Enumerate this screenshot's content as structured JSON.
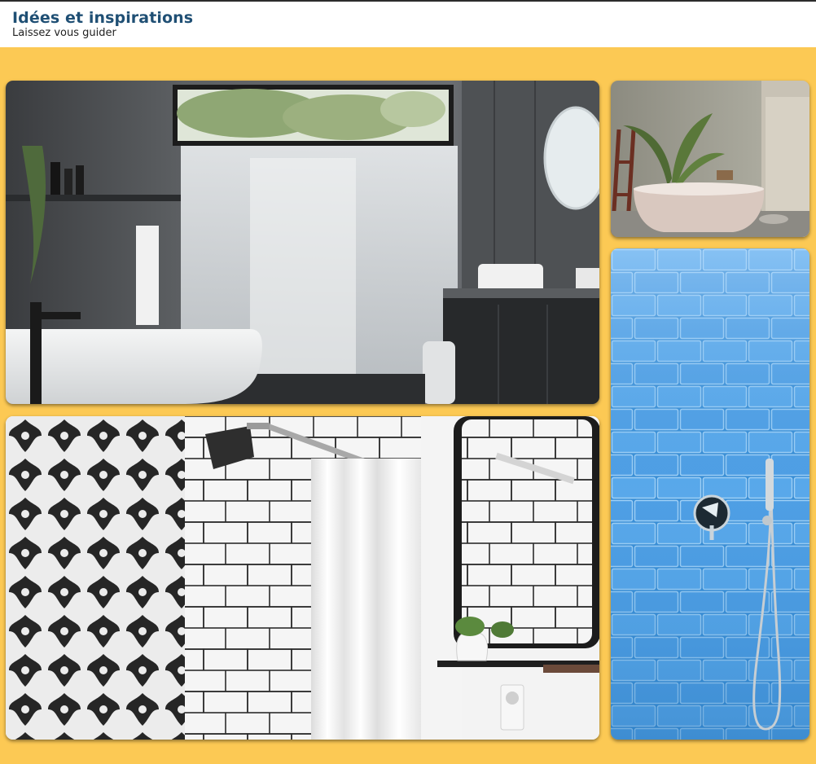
{
  "header": {
    "title": "Idées et inspirations",
    "subtitle": "Laissez vous guider"
  },
  "gallery": {
    "background_color": "#fcc954",
    "images": [
      {
        "subject": "modern dark bathroom with freestanding tub and glass shower"
      },
      {
        "subject": "freestanding bathtub with palm plant"
      },
      {
        "subject": "patterned tiles, white subway tiles and shower curtain"
      },
      {
        "subject": "blue subway tile shower wall with handheld shower"
      }
    ]
  }
}
